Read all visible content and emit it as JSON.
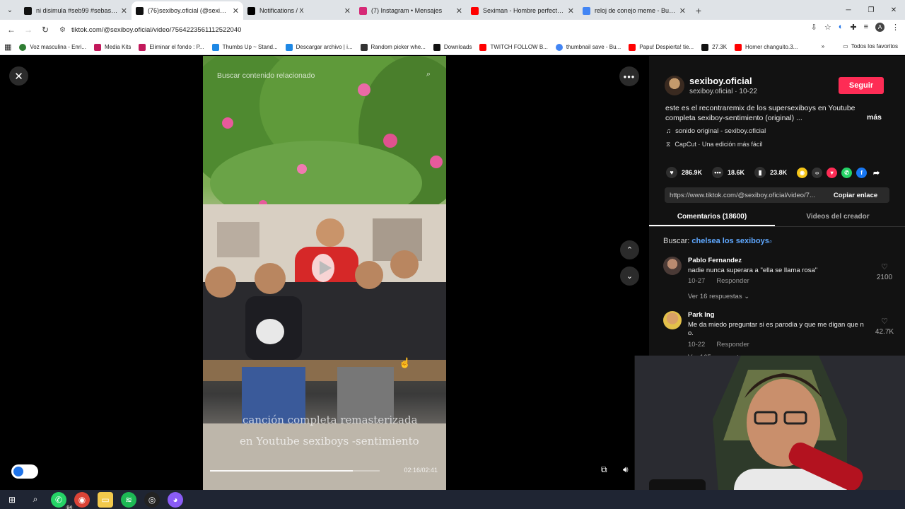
{
  "browser": {
    "tabs": [
      {
        "title": "ni disimula #seb99 #sebastian",
        "color": "#111111",
        "active": false
      },
      {
        "title": "(76)sexiboy.oficial (@sexiboy.o",
        "color": "#111111",
        "active": true
      },
      {
        "title": "Notifications / X",
        "color": "#000000",
        "active": false
      },
      {
        "title": "(7) Instagram • Mensajes",
        "color": "#d62976",
        "active": false
      },
      {
        "title": "Seximan - Hombre perfecto - Pi",
        "color": "#ff0000",
        "active": false
      },
      {
        "title": "reloj de conejo meme - Buscar",
        "color": "#4285f4",
        "active": false
      }
    ],
    "url": "tiktok.com/@sexiboy.oficial/video/7564223561112522040",
    "bookmarks": [
      {
        "label": "Voz masculina - Enri...",
        "color": "#2e7d32"
      },
      {
        "label": "Media Kits",
        "color": "#c2185b"
      },
      {
        "label": "Eliminar el fondo : P...",
        "color": "#c2185b"
      },
      {
        "label": "Thumbs Up ~ Stand...",
        "color": "#1e88e5"
      },
      {
        "label": "Descargar archivo | i...",
        "color": "#1e88e5"
      },
      {
        "label": "Random picker whe...",
        "color": "#333333"
      },
      {
        "label": "Downloads",
        "color": "#111111"
      },
      {
        "label": "TWITCH FOLLOW B...",
        "color": "#ff0000"
      },
      {
        "label": "thumbnail save - Bu...",
        "color": "#4285f4"
      },
      {
        "label": "Papu! Despierta! tie...",
        "color": "#ff0000"
      },
      {
        "label": "27.3K",
        "color": "#111111"
      },
      {
        "label": "Homer changuito.3...",
        "color": "#ff0000"
      }
    ],
    "all_bookmarks": "Todos los favoritos"
  },
  "video": {
    "search_placeholder": "Buscar contenido relacionado",
    "caption_line1": "canción completa remasterizada",
    "caption_line2": "en Youtube sexiboys -sentimiento",
    "time": "02:16/02:41",
    "progress": 0.84
  },
  "panel": {
    "username": "sexiboy.oficial",
    "sub": "sexiboy.oficial · 10-22",
    "follow": "Seguir",
    "description": "este es el recontraremix de los supersexiboys en Youtube completa sexiboy-sentimiento (original) ...",
    "more": "más",
    "music": "sonido original - sexiboy.oficial",
    "capcut": "CapCut · Una edición más fácil",
    "likes": "286.9K",
    "comments": "18.6K",
    "saves": "23.8K",
    "link": "https://www.tiktok.com/@sexiboy.oficial/video/7...",
    "copy": "Copiar enlace",
    "tab_comments": "Comentarios (18600)",
    "tab_videos": "Videos del creador",
    "search_prefix": "Buscar:",
    "search_term": "chelsea los sexiboys",
    "comment_list": [
      {
        "name": "Pablo Fernandez",
        "text": "nadie nunca superara a \"ella se llama rosa\"",
        "date": "10-27",
        "reply": "Responder",
        "likes": "2100",
        "replies": "Ver 16 respuestas ⌄"
      },
      {
        "name": "Park Ing",
        "text": "Me da miedo preguntar si es parodia y que me digan que n o.",
        "date": "10-22",
        "reply": "Responder",
        "likes": "42.7K",
        "replies": "Ver 165 respuestas ⌄"
      }
    ]
  },
  "taskbar": {
    "whatsapp_badge": "84"
  }
}
